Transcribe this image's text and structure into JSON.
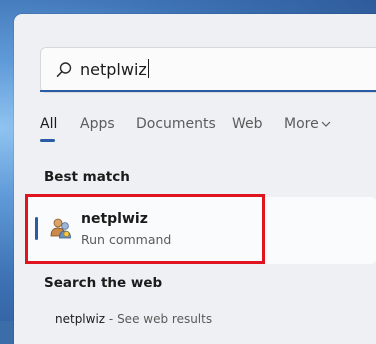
{
  "search": {
    "query": "netplwiz"
  },
  "tabs": [
    {
      "label": "All",
      "active": true
    },
    {
      "label": "Apps"
    },
    {
      "label": "Documents"
    },
    {
      "label": "Web"
    },
    {
      "label": "More"
    }
  ],
  "sections": {
    "best_match": "Best match",
    "search_web": "Search the web"
  },
  "best_match": {
    "name": "netplwiz",
    "type": "Run command",
    "icon": "users-icon"
  },
  "web_suggestion": {
    "query": "netplwiz",
    "hint": "- See web results"
  },
  "colors": {
    "accent": "#2a5ba5",
    "highlight_border": "#e0141e",
    "panel": "#eef0f3"
  }
}
